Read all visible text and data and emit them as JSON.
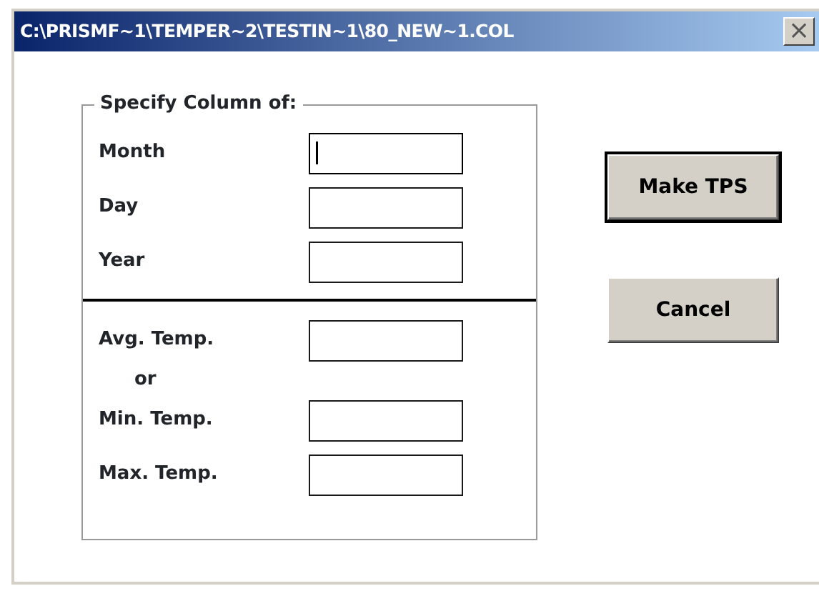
{
  "window": {
    "title": "C:\\PRISMF~1\\TEMPER~2\\TESTIN~1\\80_NEW~1.COL",
    "close": "×"
  },
  "group": {
    "title": "Specify Column of:",
    "items": [
      {
        "kind": "field",
        "label": "Month",
        "focused": true
      },
      {
        "kind": "field",
        "label": "Day",
        "focused": false
      },
      {
        "kind": "field",
        "label": "Year",
        "focused": false
      },
      {
        "kind": "divider"
      },
      {
        "kind": "field",
        "label": "Avg. Temp.",
        "focused": false
      },
      {
        "kind": "note",
        "label": "or"
      },
      {
        "kind": "field",
        "label": "Min. Temp.",
        "focused": false
      },
      {
        "kind": "field",
        "label": "Max. Temp.",
        "focused": false
      }
    ]
  },
  "buttons": [
    {
      "label": "Make TPS",
      "default": true
    },
    {
      "label": "Cancel",
      "default": false
    }
  ]
}
